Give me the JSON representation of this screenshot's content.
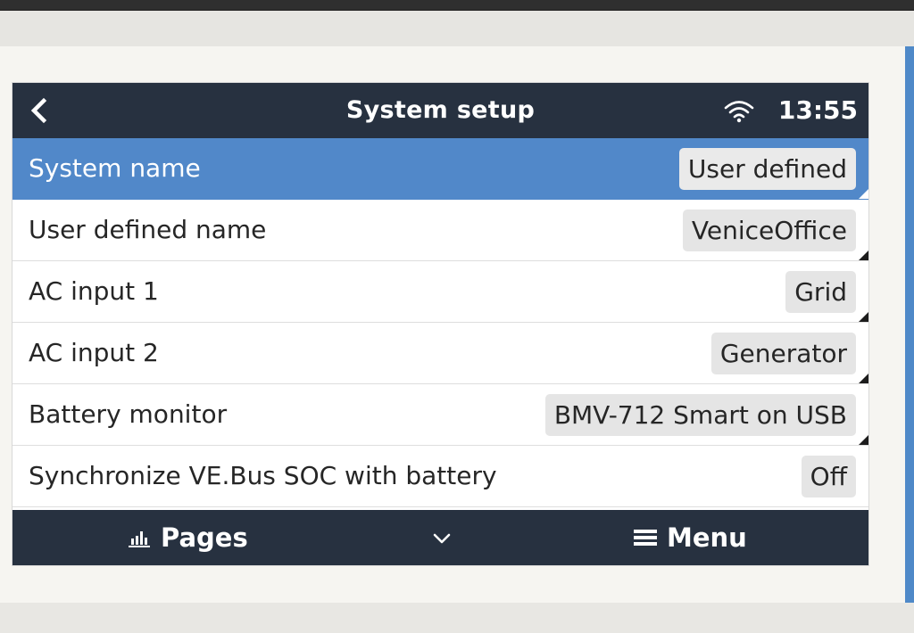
{
  "header": {
    "back_icon": "chevron-left-icon",
    "title": "System setup",
    "wifi_icon": "wifi-icon",
    "time": "13:55"
  },
  "settings": {
    "rows": [
      {
        "label": "System name",
        "value": "User defined",
        "selected": true
      },
      {
        "label": "User defined name",
        "value": "VeniceOffice",
        "selected": false
      },
      {
        "label": "AC input 1",
        "value": "Grid",
        "selected": false
      },
      {
        "label": "AC input 2",
        "value": "Generator",
        "selected": false
      },
      {
        "label": "Battery monitor",
        "value": "BMV-712 Smart on USB",
        "selected": false
      },
      {
        "label": "Synchronize VE.Bus SOC with battery",
        "value": "Off",
        "selected": false
      }
    ]
  },
  "footer": {
    "pages_label": "Pages",
    "pages_icon": "bar-chart-icon",
    "chevron_icon": "chevron-down-icon",
    "menu_label": "Menu",
    "menu_icon": "hamburger-icon"
  },
  "colors": {
    "header_bg": "#273140",
    "selected_row": "#5188c9",
    "value_box": "#e5e5e5",
    "accent": "#4f89c8"
  }
}
